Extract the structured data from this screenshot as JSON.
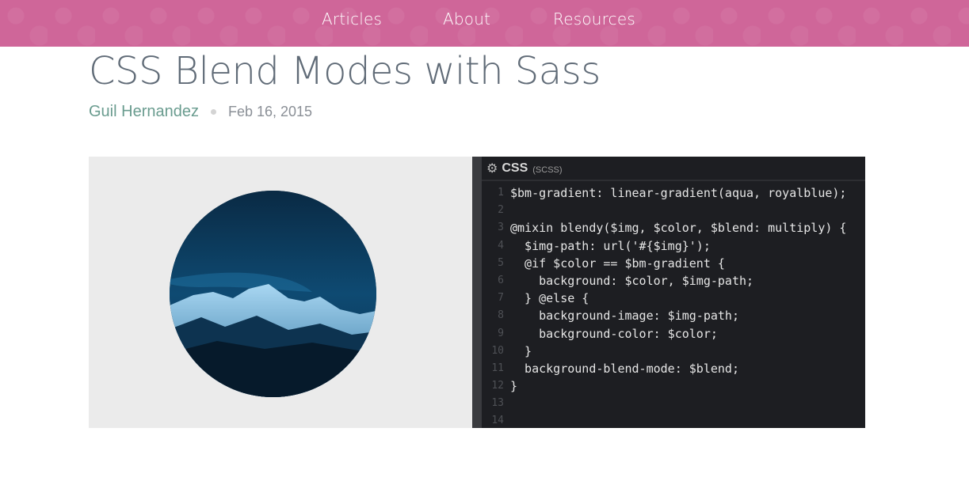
{
  "nav": {
    "items": [
      {
        "label": "Articles"
      },
      {
        "label": "About"
      },
      {
        "label": "Resources"
      }
    ]
  },
  "article": {
    "title": "CSS Blend Modes with Sass",
    "author": "Guil Hernandez",
    "date": "Feb 16, 2015"
  },
  "editor": {
    "icon": "gear-icon",
    "language": "CSS",
    "sublabel": "(SCSS)",
    "lines": [
      {
        "num": "1",
        "text": "$bm-gradient: linear-gradient(aqua, royalblue);"
      },
      {
        "num": "2",
        "text": ""
      },
      {
        "num": "3",
        "text": "@mixin blendy($img, $color, $blend: multiply) {"
      },
      {
        "num": "4",
        "text": "  $img-path: url('#{$img}');"
      },
      {
        "num": "5",
        "text": "  @if $color == $bm-gradient {"
      },
      {
        "num": "6",
        "text": "    background: $color, $img-path;"
      },
      {
        "num": "7",
        "text": "  } @else {"
      },
      {
        "num": "8",
        "text": "    background-image: $img-path;"
      },
      {
        "num": "9",
        "text": "    background-color: $color;"
      },
      {
        "num": "10",
        "text": "  }"
      },
      {
        "num": "11",
        "text": "  background-blend-mode: $blend;"
      },
      {
        "num": "12",
        "text": "}"
      },
      {
        "num": "13",
        "text": ""
      },
      {
        "num": "14",
        "text": ""
      }
    ]
  },
  "colors": {
    "nav_background": "#cf6699",
    "title": "#606b77",
    "author": "#6a9c8f",
    "editor_background": "#1d1e22"
  }
}
